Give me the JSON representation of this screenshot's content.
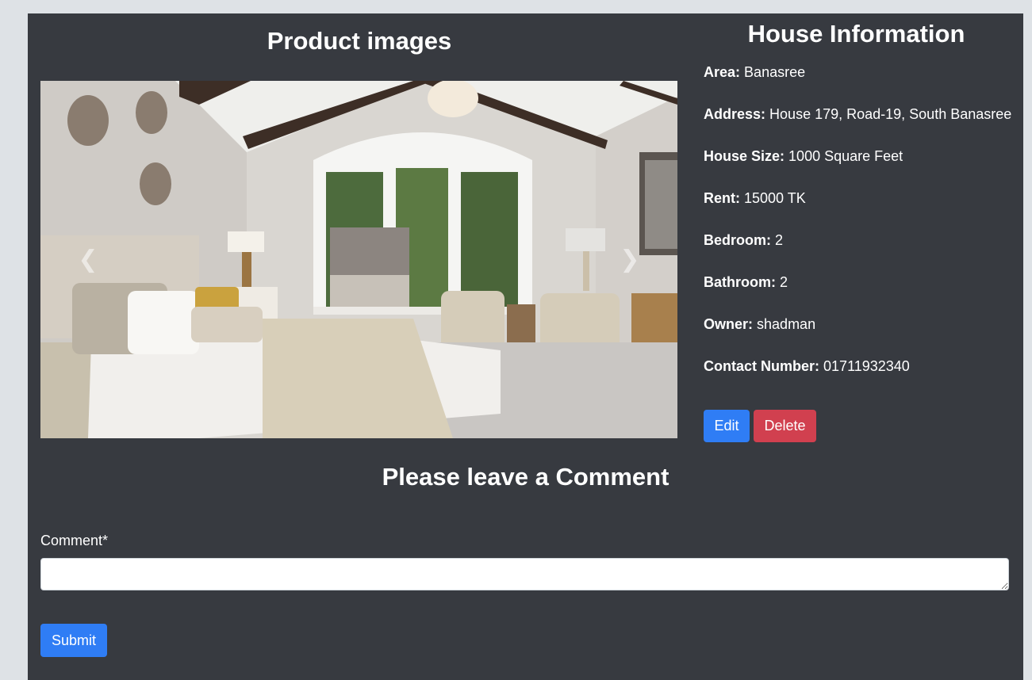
{
  "product": {
    "title": "Product images"
  },
  "house": {
    "title": "House Information",
    "fields": [
      {
        "label": "Area:",
        "value": "Banasree"
      },
      {
        "label": "Address:",
        "value": "House 179, Road-19, South Banasree"
      },
      {
        "label": "House Size:",
        "value": "1000 Square Feet"
      },
      {
        "label": "Rent:",
        "value": "15000 TK"
      },
      {
        "label": "Bedroom:",
        "value": "2"
      },
      {
        "label": "Bathroom:",
        "value": "2"
      },
      {
        "label": "Owner:",
        "value": "shadman"
      },
      {
        "label": "Contact Number:",
        "value": "01711932340"
      }
    ]
  },
  "actions": {
    "edit_label": "Edit",
    "delete_label": "Delete"
  },
  "comment": {
    "title": "Please leave a Comment",
    "label": "Comment*",
    "value": "",
    "submit_label": "Submit"
  },
  "icons": {
    "prev": "chevron-left-icon",
    "next": "chevron-right-icon"
  },
  "colors": {
    "panel": "#373a40",
    "primary": "#2f7df5",
    "danger": "#d1404f",
    "background": "#dee2e6"
  }
}
